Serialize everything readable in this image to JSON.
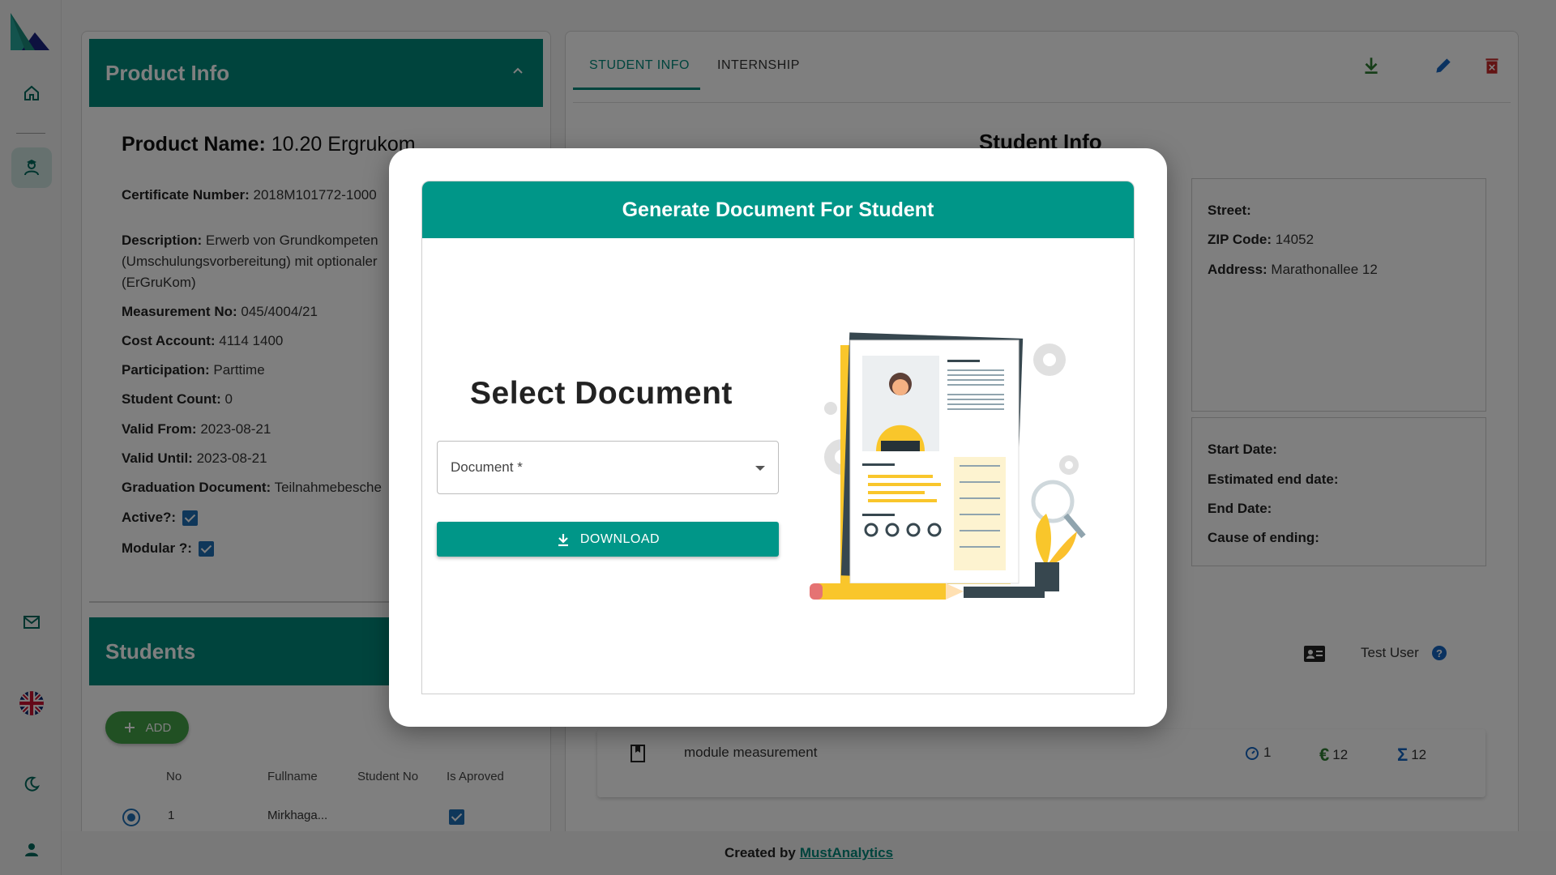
{
  "sidebar": {
    "items": [
      "home-icon",
      "student-icon",
      "mail-icon",
      "language-flag-icon",
      "dark-mode-icon",
      "profile-icon"
    ]
  },
  "product_info": {
    "header": "Product Info",
    "name_label": "Product Name:",
    "name_value": "10.20 Ergrukom",
    "fields": [
      {
        "label": "Certificate Number:",
        "value": "2018M101772-1000"
      },
      {
        "label": "Description:",
        "value": "Erwerb von Grundkompeten"
      },
      {
        "label": "",
        "value": "(Umschulungsvorbereitung) mit optionaler"
      },
      {
        "label": "",
        "value": "(ErGruKom)"
      },
      {
        "label": "Measurement No:",
        "value": "045/4004/21"
      },
      {
        "label": "Cost Account:",
        "value": "4114 1400"
      },
      {
        "label": "Participation:",
        "value": "Parttime"
      },
      {
        "label": "Student Count:",
        "value": "0"
      },
      {
        "label": "Valid From:",
        "value": "2023-08-21"
      },
      {
        "label": "Valid Until:",
        "value": "2023-08-21"
      },
      {
        "label": "Graduation Document:",
        "value": "Teilnahmebesche"
      }
    ],
    "active_label": "Active?:",
    "modular_label": "Modular ?:"
  },
  "students": {
    "header": "Students",
    "add_label": "ADD",
    "columns": [
      "No",
      "Fullname",
      "Student No",
      "Is Aproved"
    ],
    "rows": [
      {
        "no": "1",
        "fullname": "Mirkhaga...",
        "student_no": ""
      }
    ]
  },
  "tabs": {
    "student_info": "STUDENT INFO",
    "internship": "INTERNSHIP"
  },
  "student_info": {
    "title": "Student Info",
    "street_label": "Street:",
    "zip_label": "ZIP Code:",
    "zip_value": "14052",
    "address_label": "Address:",
    "address_value": "Marathonallee 12",
    "start_label": "Start Date:",
    "est_end_label": "Estimated end date:",
    "end_label": "End Date:",
    "cause_label": "Cause of ending:",
    "test_user": "Test User",
    "module_label": "module measurement",
    "stat_time": "1",
    "stat_euro": "12",
    "stat_sum": "12"
  },
  "footer": {
    "prefix": "Created by",
    "link": "MustAnalytics"
  },
  "modal": {
    "title": "Generate Document For Student",
    "select_title": "Select Document",
    "document_label": "Document *",
    "download_label": "DOWNLOAD"
  },
  "colors": {
    "primary": "#00897b",
    "add_green": "#43a047",
    "checkbox_blue": "#1e6fb5",
    "delete_red": "#c62828"
  }
}
